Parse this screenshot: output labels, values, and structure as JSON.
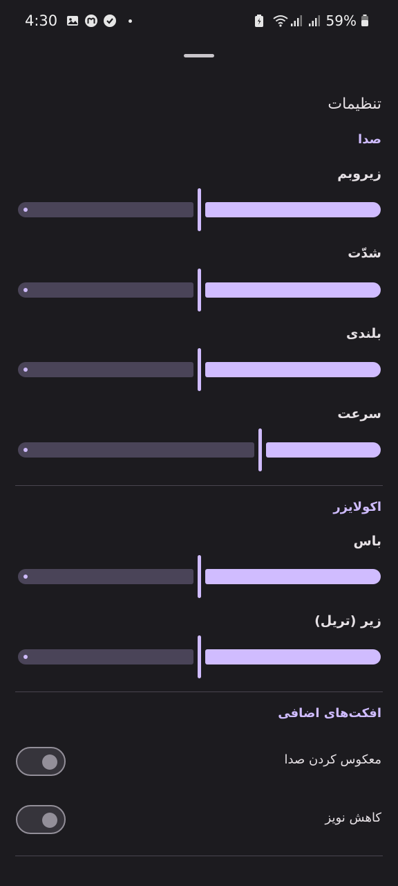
{
  "status_bar": {
    "time": "4:30",
    "battery_percent": "59%",
    "left_icons": [
      "gallery-icon",
      "app-m-icon",
      "shield-check-icon",
      "notification-dot-icon"
    ],
    "right_icons": [
      "battery-saver-icon",
      "wifi-icon",
      "signal-icon",
      "signal-icon",
      "battery-icon"
    ]
  },
  "page": {
    "title": "تنظیمات"
  },
  "sections": {
    "sound": {
      "header": "صدا"
    },
    "equalizer": {
      "header": "اکولایزر"
    },
    "effects": {
      "header": "افکت‌های اضافی"
    }
  },
  "sliders": [
    {
      "label": "زیروبم",
      "value": 0.5
    },
    {
      "label": "شدّت",
      "value": 0.5
    },
    {
      "label": "بلندی",
      "value": 0.5
    },
    {
      "label": "سرعت",
      "value": 0.667
    },
    {
      "label": "باس",
      "value": 0.5
    },
    {
      "label": "زیر (تریل)",
      "value": 0.5
    }
  ],
  "switches": [
    {
      "label": "معکوس کردن صدا",
      "on": false
    },
    {
      "label": "کاهش نویز",
      "on": false
    }
  ],
  "colors": {
    "background": "#1c1b1f",
    "accent": "#d0bcff",
    "track_inactive": "#4a4458",
    "section_header": "#cfbcff"
  }
}
